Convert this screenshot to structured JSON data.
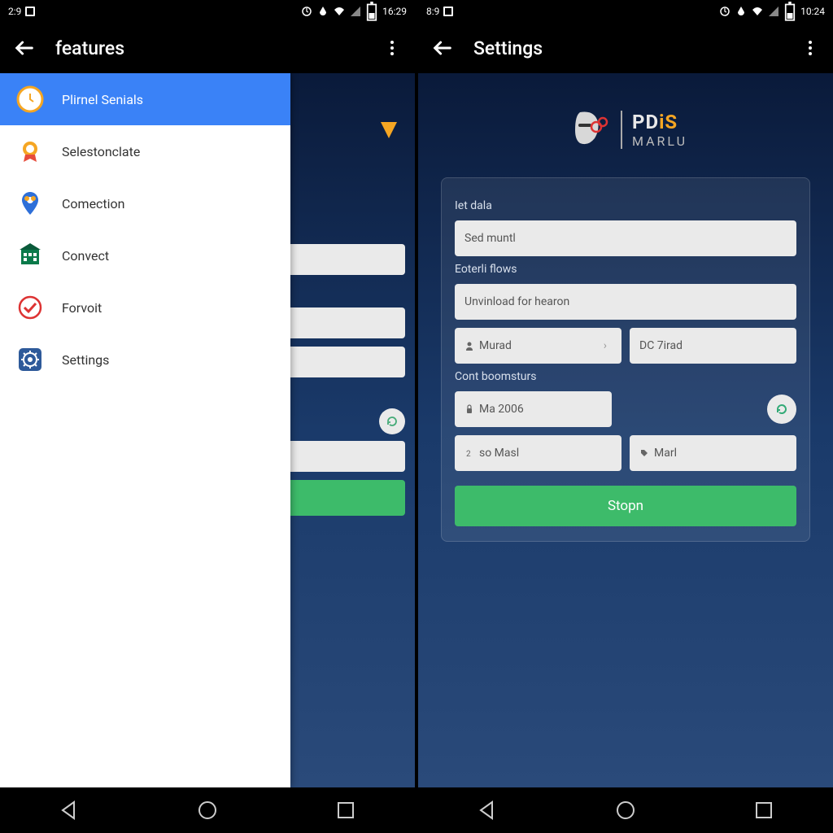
{
  "left": {
    "status": {
      "time": "16:29",
      "notif": "2:9"
    },
    "appbar": {
      "title": "features"
    },
    "drawer": {
      "items": [
        {
          "label": "Plirnel Senials",
          "icon": "clock-icon"
        },
        {
          "label": "Selestonclate",
          "icon": "badge-icon"
        },
        {
          "label": "Comection",
          "icon": "pin-icon"
        },
        {
          "label": "Convect",
          "icon": "building-icon"
        },
        {
          "label": "Forvoit",
          "icon": "check-icon"
        },
        {
          "label": "Settings",
          "icon": "gear-icon"
        }
      ]
    }
  },
  "right": {
    "status": {
      "time": "10:24",
      "notif": "8:9"
    },
    "appbar": {
      "title": "Settings"
    },
    "logo": {
      "line1a": "PD",
      "line1b": "iS",
      "line2": "MARLU"
    },
    "form": {
      "label1": "Iet dala",
      "input1": "Sed muntl",
      "label2": "Eoterli flows",
      "input2": "Unvinload for hearon",
      "input3": "Murad",
      "input4": "DC 7irad",
      "label3": "Cont boomsturs",
      "input5": "Ma 2006",
      "input6": "so Masl",
      "input7": "Marl",
      "submit": "Stopn"
    }
  }
}
